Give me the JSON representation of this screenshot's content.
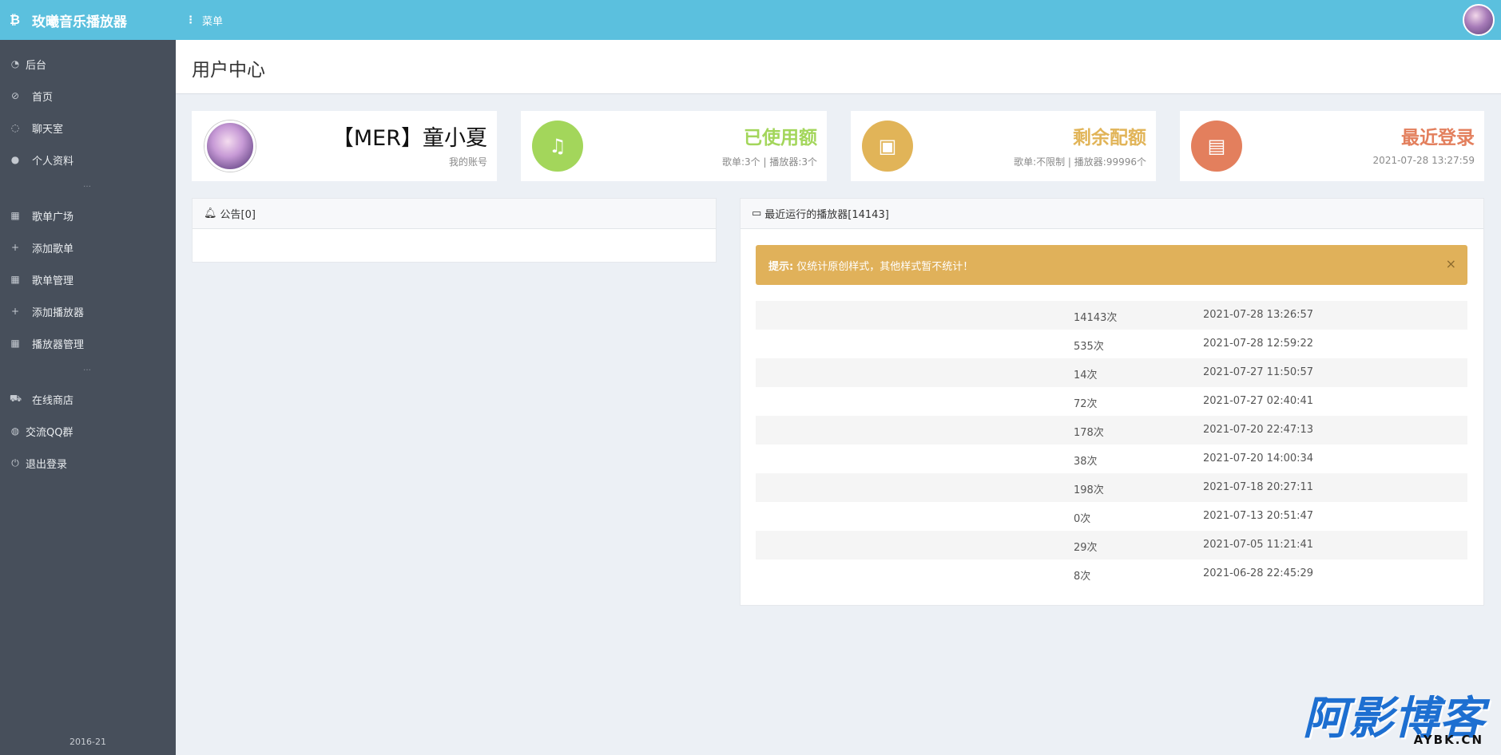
{
  "brand": {
    "title": "玫曦音乐播放器",
    "icon": "bitcoin-icon"
  },
  "topbar": {
    "menu_label": "菜单"
  },
  "sidebar": {
    "items": [
      {
        "label": "后台",
        "icon": "pie-chart-icon"
      },
      {
        "label": "首页",
        "icon": "dashboard-icon"
      },
      {
        "label": "聊天室",
        "icon": "comment-icon"
      },
      {
        "label": "个人资料",
        "icon": "user-icon"
      },
      {
        "label": "歌单广场",
        "icon": "table-icon"
      },
      {
        "label": "添加歌单",
        "icon": "plus-icon"
      },
      {
        "label": "歌单管理",
        "icon": "table-icon"
      },
      {
        "label": "添加播放器",
        "icon": "plus-icon"
      },
      {
        "label": "播放器管理",
        "icon": "table-icon"
      },
      {
        "label": "在线商店",
        "icon": "cart-icon"
      },
      {
        "label": "交流QQ群",
        "icon": "globe-icon"
      },
      {
        "label": "退出登录",
        "icon": "power-icon"
      }
    ],
    "separator": "…",
    "copyright": "2016-21"
  },
  "page": {
    "title": "用户中心"
  },
  "cards": {
    "user": {
      "name": "【MER】童小夏",
      "sub": "我的账号"
    },
    "used": {
      "title": "已使用额",
      "sub": "歌单:3个 | 播放器:3个",
      "color": "#a3d65b"
    },
    "remain": {
      "title": "剩余配额",
      "sub": "歌单:不限制 | 播放器:99996个",
      "color": "#e1b458"
    },
    "login": {
      "title": "最近登录",
      "sub": "2021-07-28 13:27:59",
      "color": "#e37f5d"
    }
  },
  "notice": {
    "title": "公告[0]"
  },
  "recent": {
    "title": "最近运行的播放器[14143]",
    "alert_strong": "提示:",
    "alert_text": "仅统计原创样式，其他样式暂不统计！",
    "close": "×",
    "rows": [
      {
        "count": "14143次",
        "time": "2021-07-28 13:26:57"
      },
      {
        "count": "535次",
        "time": "2021-07-28 12:59:22"
      },
      {
        "count": "14次",
        "time": "2021-07-27 11:50:57"
      },
      {
        "count": "72次",
        "time": "2021-07-27 02:40:41"
      },
      {
        "count": "178次",
        "time": "2021-07-20 22:47:13"
      },
      {
        "count": "38次",
        "time": "2021-07-20 14:00:34"
      },
      {
        "count": "198次",
        "time": "2021-07-18 20:27:11"
      },
      {
        "count": "0次",
        "time": "2021-07-13 20:51:47"
      },
      {
        "count": "29次",
        "time": "2021-07-05 11:21:41"
      },
      {
        "count": "8次",
        "time": "2021-06-28 22:45:29"
      }
    ]
  },
  "watermark": {
    "main": "阿影博客",
    "sub": "AYBK.CN"
  }
}
